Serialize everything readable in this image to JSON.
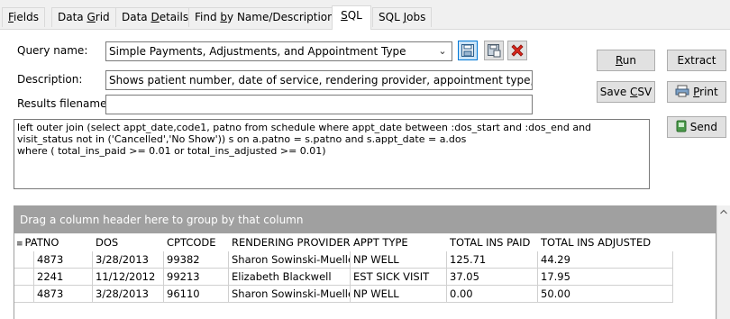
{
  "tabs": [
    {
      "label": "Fields",
      "u": "F",
      "rest": "ields"
    },
    {
      "label": "Data Grid",
      "pre": "Data ",
      "u": "G",
      "rest": "rid"
    },
    {
      "label": "Data Details",
      "pre": "Data ",
      "u": "D",
      "rest": "etails"
    },
    {
      "label": "Find by Name/Description",
      "pre": "Find ",
      "u": "b",
      "rest": "y Name/Description"
    },
    {
      "label": "SQL",
      "u": "S",
      "rest": "QL"
    },
    {
      "label": "SQL Jobs",
      "pre": "SQL ",
      "u": "J",
      "rest": "obs"
    }
  ],
  "active_tab": "SQL",
  "form": {
    "query_name_label": "Query name:",
    "query_name_value": "Simple Payments, Adjustments, and Appointment Type",
    "description_label": "Description:",
    "description_value": "Shows patient number, date of service, rendering provider, appointment type, CPT",
    "results_filename_label": "Results filename:",
    "results_filename_value": ""
  },
  "buttons": {
    "run": {
      "u": "R",
      "rest": "un"
    },
    "extract": {
      "label": "Extract"
    },
    "save_csv": {
      "pre": "Save ",
      "u": "C",
      "rest": "SV"
    },
    "print": {
      "u": "P",
      "rest": "rint"
    },
    "send": {
      "label": "Send"
    }
  },
  "sql_lines": [
    "left outer join (select appt_date,code1, patno from schedule where appt_date between :dos_start and :dos_end and",
    "visit_status not in ('Cancelled','No Show')) s on a.patno = s.patno and s.appt_date = a.dos",
    "where ( total_ins_paid >= 0.01 or total_ins_adjusted >= 0.01)"
  ],
  "grid": {
    "group_prompt": "Drag a column header here to group by that column",
    "columns": [
      "PATNO",
      "DOS",
      "CPTCODE",
      "RENDERING PROVIDER",
      "APPT TYPE",
      "TOTAL INS PAID",
      "TOTAL INS ADJUSTED"
    ],
    "rows": [
      [
        "4873",
        "3/28/2013",
        "99382",
        "Sharon Sowinski-Mueller",
        "NP WELL",
        "125.71",
        "44.29"
      ],
      [
        "2241",
        "11/12/2012",
        "99213",
        "Elizabeth Blackwell",
        "EST SICK VISIT",
        "37.05",
        "17.95"
      ],
      [
        "4873",
        "3/28/2013",
        "96110",
        "Sharon Sowinski-Mueller",
        "NP WELL",
        "0.00",
        "50.00"
      ]
    ]
  }
}
